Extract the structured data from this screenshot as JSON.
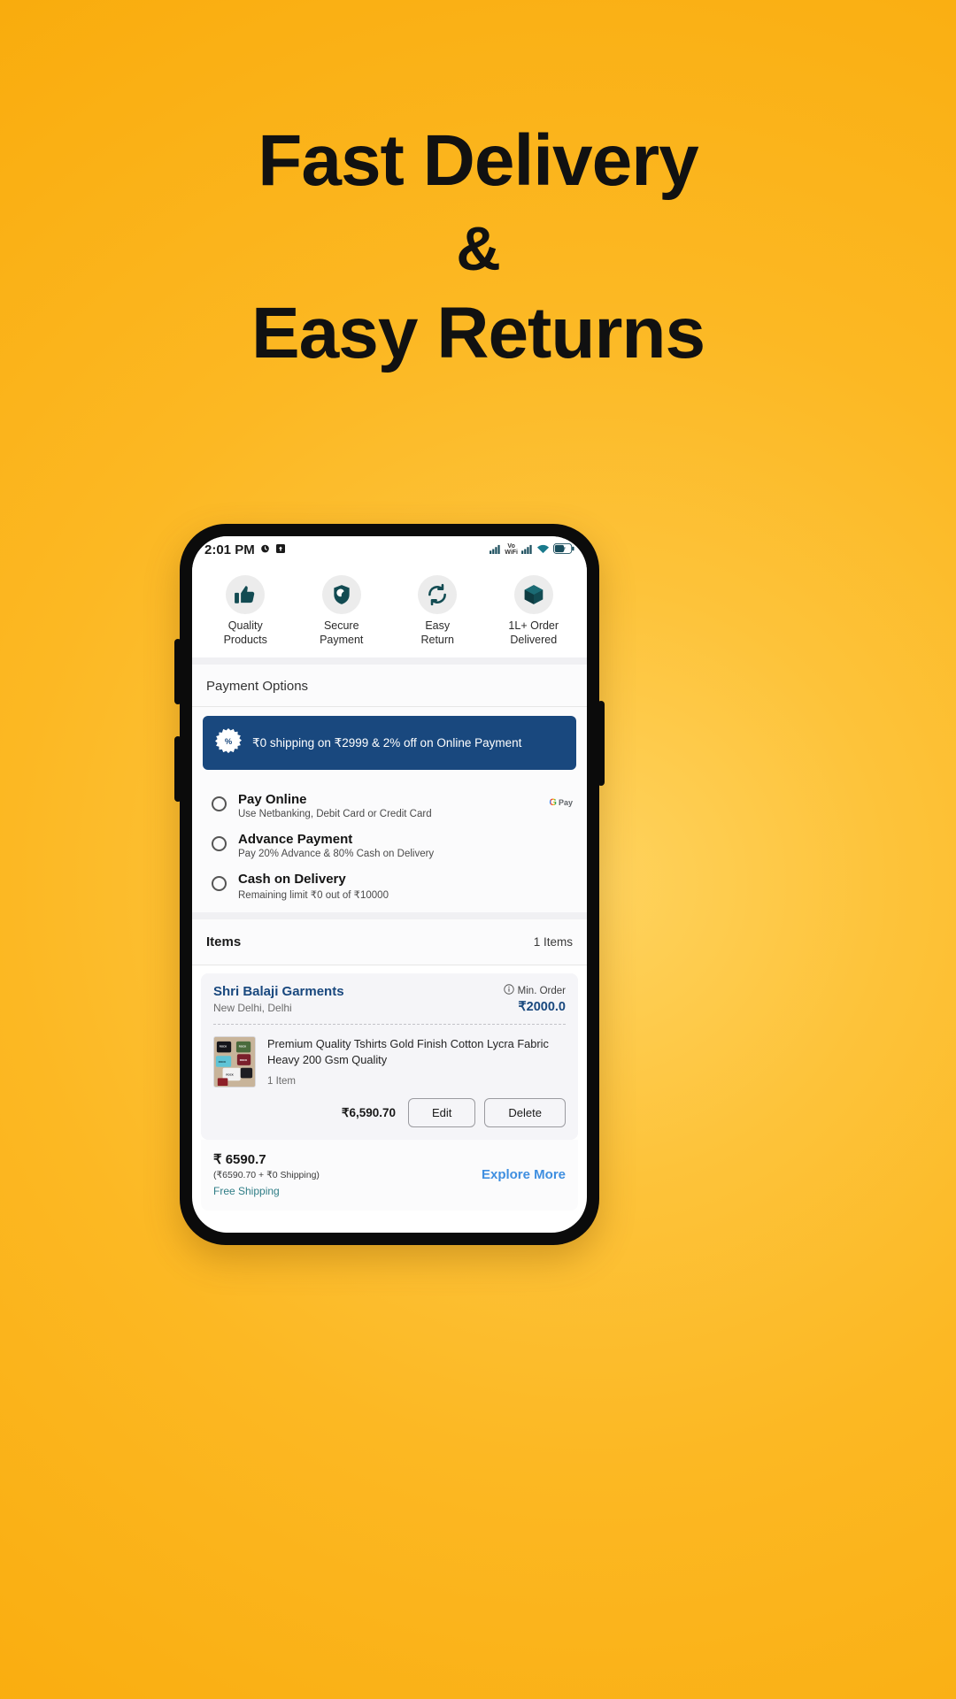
{
  "promo_headline": {
    "line1": "Fast Delivery",
    "line2": "&",
    "line3": "Easy Returns"
  },
  "colors": {
    "background_start": "#FFD35E",
    "background_end": "#F9AC0D",
    "brand_navy": "#19487e",
    "link_blue": "#3f8fe0",
    "teal": "#2f7d86"
  },
  "phone": {
    "statusbar": {
      "time": "2:01 PM",
      "icons_left": [
        "alarm-icon",
        "upload-icon"
      ],
      "vo": "Vo",
      "wifi_label": "WiFi",
      "battery": "57",
      "icons_right": [
        "signal-icon",
        "volte-icon",
        "signal2-icon",
        "wifi-icon",
        "battery-icon"
      ]
    },
    "features": [
      {
        "icon": "thumbs-up-icon",
        "label": "Quality\nProducts",
        "line1": "Quality",
        "line2": "Products"
      },
      {
        "icon": "shield-moon-icon",
        "label": "Secure Payment",
        "line1": "Secure",
        "line2": "Payment"
      },
      {
        "icon": "refresh-icon",
        "label": "Easy Return",
        "line1": "Easy",
        "line2": "Return"
      },
      {
        "icon": "box-icon",
        "label": "1L+ Order Delivered",
        "line1": "1L+ Order",
        "line2": "Delivered"
      }
    ],
    "payment": {
      "title": "Payment Options",
      "banner": {
        "icon": "percent-badge-icon",
        "text": "₹0 shipping on ₹2999 & 2% off on Online Payment"
      },
      "options": [
        {
          "name": "Pay Online",
          "desc": "Use Netbanking, Debit Card or Credit Card",
          "selected": false,
          "logo": "gpay-logo",
          "logo_g": "G",
          "logo_pay": "Pay"
        },
        {
          "name": "Advance Payment",
          "desc": "Pay 20% Advance & 80% Cash on Delivery",
          "selected": false
        },
        {
          "name": "Cash on Delivery",
          "desc": "Remaining limit ₹0 out of ₹10000",
          "selected": false
        }
      ]
    },
    "items": {
      "title": "Items",
      "count_label": "1 Items",
      "seller": {
        "name": "Shri Balaji Garments",
        "location": "New Delhi, Delhi",
        "min_order_label": "Min. Order",
        "min_order_icon": "info-icon",
        "min_order_value": "₹2000.0"
      },
      "product": {
        "title": "Premium Quality Tshirts Gold Finish Cotton Lycra Fabric Heavy 200 Gsm Quality",
        "quantity": "1 Item",
        "price": "₹6,590.70",
        "edit_label": "Edit",
        "delete_label": "Delete",
        "thumbnail": "tshirts-photo"
      },
      "summary": {
        "total": "₹ 6590.7",
        "breakdown": "(₹6590.70 + ₹0 Shipping)",
        "free_shipping": "Free Shipping",
        "explore_label": "Explore More"
      }
    }
  }
}
